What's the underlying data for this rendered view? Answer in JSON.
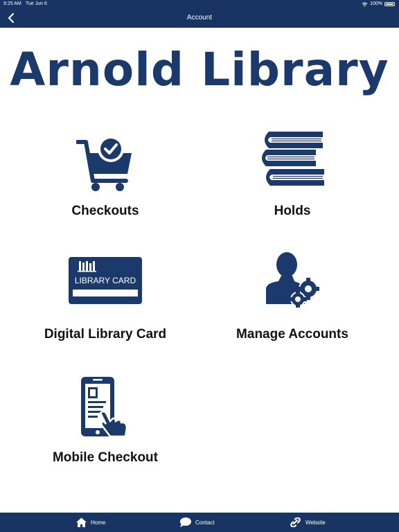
{
  "status_bar": {
    "time": "9:25 AM",
    "date": "Tue Jun 6",
    "battery": "100%"
  },
  "nav": {
    "title": "Account",
    "back_icon": "chevron-left-icon"
  },
  "logo": {
    "text": "Arnold Library"
  },
  "tiles": [
    {
      "label": "Checkouts",
      "icon": "cart-check-icon"
    },
    {
      "label": "Holds",
      "icon": "books-icon"
    },
    {
      "label": "Digital Library Card",
      "icon": "library-card-icon",
      "card_text": "LIBRARY CARD"
    },
    {
      "label": "Manage Accounts",
      "icon": "user-gears-icon"
    },
    {
      "label": "Mobile Checkout",
      "icon": "phone-tap-icon"
    }
  ],
  "tabbar": [
    {
      "label": "Home",
      "icon": "home-icon"
    },
    {
      "label": "Contact",
      "icon": "chat-bubble-icon"
    },
    {
      "label": "Website",
      "icon": "link-icon"
    }
  ],
  "colors": {
    "brand": "#173463",
    "icon": "#1b3a6b",
    "background": "#ffffff"
  }
}
